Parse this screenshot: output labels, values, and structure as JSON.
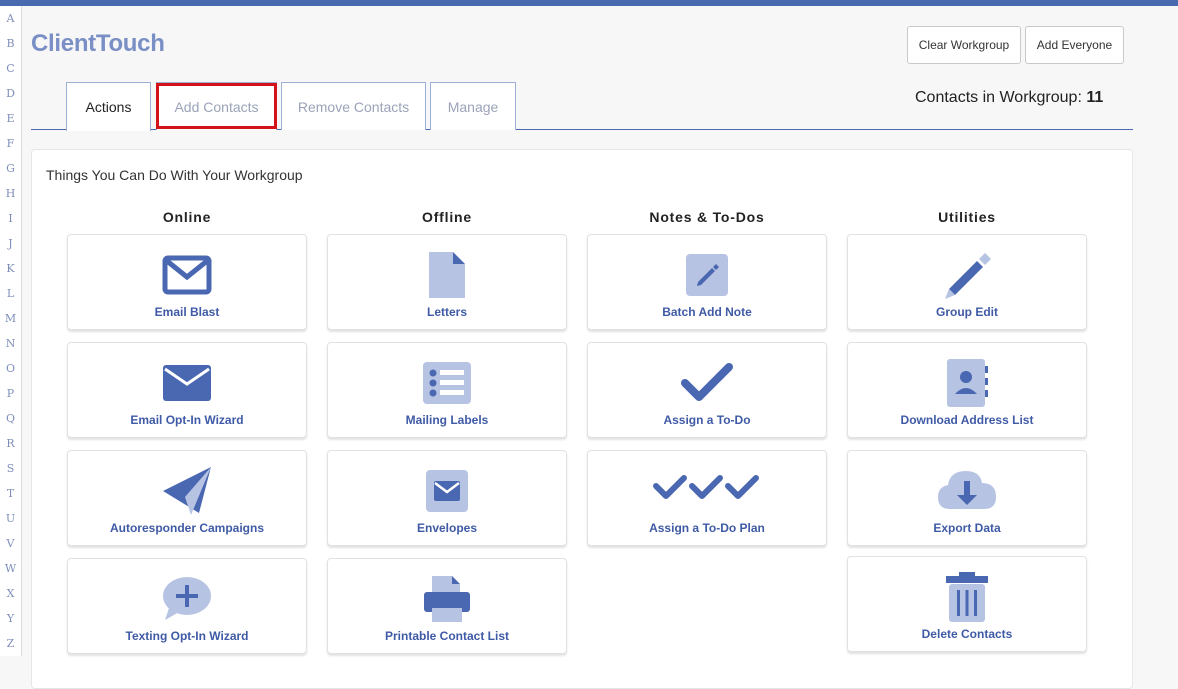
{
  "app": {
    "title": "ClientTouch"
  },
  "alphabet": [
    "A",
    "B",
    "C",
    "D",
    "E",
    "F",
    "G",
    "H",
    "I",
    "J",
    "K",
    "L",
    "M",
    "N",
    "O",
    "P",
    "Q",
    "R",
    "S",
    "T",
    "U",
    "V",
    "W",
    "X",
    "Y",
    "Z"
  ],
  "header": {
    "clear_workgroup": "Clear Workgroup",
    "add_everyone": "Add Everyone",
    "contacts_label": "Contacts in Workgroup:",
    "contacts_count": "11"
  },
  "tabs": [
    {
      "label": "Actions",
      "active": true
    },
    {
      "label": "Add Contacts",
      "active": false
    },
    {
      "label": "Remove Contacts",
      "active": false
    },
    {
      "label": "Manage",
      "active": false
    }
  ],
  "panel": {
    "title": "Things You Can Do With Your Workgroup",
    "columns": [
      {
        "heading": "Online",
        "items": [
          {
            "label": "Email Blast",
            "icon": "envelope-icon"
          },
          {
            "label": "Email Opt-In Wizard",
            "icon": "envelope-icon"
          },
          {
            "label": "Autoresponder Campaigns",
            "icon": "paper-plane-icon"
          },
          {
            "label": "Texting Opt-In Wizard",
            "icon": "chat-plus-icon"
          }
        ]
      },
      {
        "heading": "Offline",
        "items": [
          {
            "label": "Letters",
            "icon": "document-icon"
          },
          {
            "label": "Mailing Labels",
            "icon": "list-icon"
          },
          {
            "label": "Envelopes",
            "icon": "envelope-square-icon"
          },
          {
            "label": "Printable Contact List",
            "icon": "printer-icon"
          }
        ]
      },
      {
        "heading": "Notes & To-Dos",
        "items": [
          {
            "label": "Batch Add Note",
            "icon": "pencil-square-icon"
          },
          {
            "label": "Assign a To-Do",
            "icon": "check-icon"
          },
          {
            "label": "Assign a To-Do Plan",
            "icon": "triple-check-icon"
          }
        ]
      },
      {
        "heading": "Utilities",
        "items": [
          {
            "label": "Group Edit",
            "icon": "pencil-icon"
          },
          {
            "label": "Download Address List",
            "icon": "address-book-icon"
          },
          {
            "label": "Export Data",
            "icon": "cloud-download-icon"
          },
          {
            "label": "Delete Contacts",
            "icon": "trash-icon"
          }
        ]
      }
    ]
  },
  "colors": {
    "accent": "#4a6ab0",
    "icon_dark": "#4a67b1",
    "icon_light": "#b6c3e2",
    "highlight": "#d2141a"
  }
}
